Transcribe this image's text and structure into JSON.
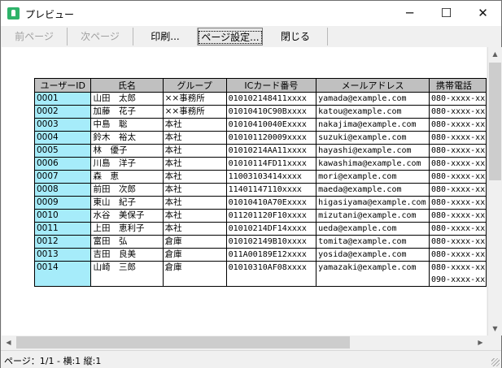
{
  "window": {
    "title": "プレビュー",
    "minimize": "─",
    "maximize": "☐",
    "close": "✕"
  },
  "toolbar": {
    "prev_page": "前ページ",
    "next_page": "次ページ",
    "print": "印刷...",
    "page_setup": "ページ設定...",
    "close": "閉じる"
  },
  "table": {
    "headers": [
      "ユーザーID",
      "氏名",
      "グループ",
      "ICカード番号",
      "メールアドレス",
      "携帯電話"
    ],
    "rows": [
      [
        "0001",
        "山田　太郎",
        "××事務所",
        "010102148411xxxx",
        "yamada@example.com",
        "080-xxxx-xx"
      ],
      [
        "0002",
        "加藤　花子",
        "××事務所",
        "010104​10C90Bxxxx",
        "katou@example.com",
        "080-xxxx-xx"
      ],
      [
        "0003",
        "中島　聡",
        "本社",
        "01010410040Exxxx",
        "nakajima@example.com",
        "080-xxxx-xx"
      ],
      [
        "0004",
        "鈴木　裕太",
        "本社",
        "010101120009xxxx",
        "suzuki@example.com",
        "080-xxxx-xx"
      ],
      [
        "0005",
        "林　優子",
        "本社",
        "01010214AA11xxxx",
        "hayashi@example.com",
        "080-xxxx-xx"
      ],
      [
        "0006",
        "川島　洋子",
        "本社",
        "010101​14FD11xxxx",
        "kawashima@example.com",
        "080-xxxx-xx"
      ],
      [
        "0007",
        "森　恵",
        "本社",
        "11003103414xxxx",
        "mori@example.com",
        "080-xxxx-xx"
      ],
      [
        "0008",
        "前田　次郎",
        "本社",
        "11401147110xxxx",
        "maeda@example.com",
        "080-xxxx-xx"
      ],
      [
        "0009",
        "東山　紀子",
        "本社",
        "01010410A70Exxxx",
        "higasiyama@example.com",
        "080-xxxx-xx"
      ],
      [
        "0010",
        "水谷　美保子",
        "本社",
        "011201120F10xxxx",
        "mizutani@example.com",
        "080-xxxx-xx"
      ],
      [
        "0011",
        "上田　恵利子",
        "本社",
        "01010214DF14xxxx",
        "ueda@example.com",
        "080-xxxx-xx"
      ],
      [
        "0012",
        "富田　弘",
        "倉庫",
        "010102149B10xxxx",
        "tomita@example.com",
        "080-xxxx-xx"
      ],
      [
        "0013",
        "吉田　良美",
        "倉庫",
        "011A00189E12xxxx",
        "yosida@example.com",
        "080-xxxx-xx"
      ],
      [
        "0014",
        "山崎　三郎",
        "倉庫",
        "01010310AF08xxxx",
        "yamazaki@example.com",
        "080-xxxx-xx"
      ]
    ],
    "extra_line_last_row": "090-xxxx-xx"
  },
  "status": {
    "text": "ページ：1/1 - 横:1 縦:1"
  },
  "scroll": {
    "up": "▲",
    "down": "▼",
    "left": "◀",
    "right": "▶"
  }
}
